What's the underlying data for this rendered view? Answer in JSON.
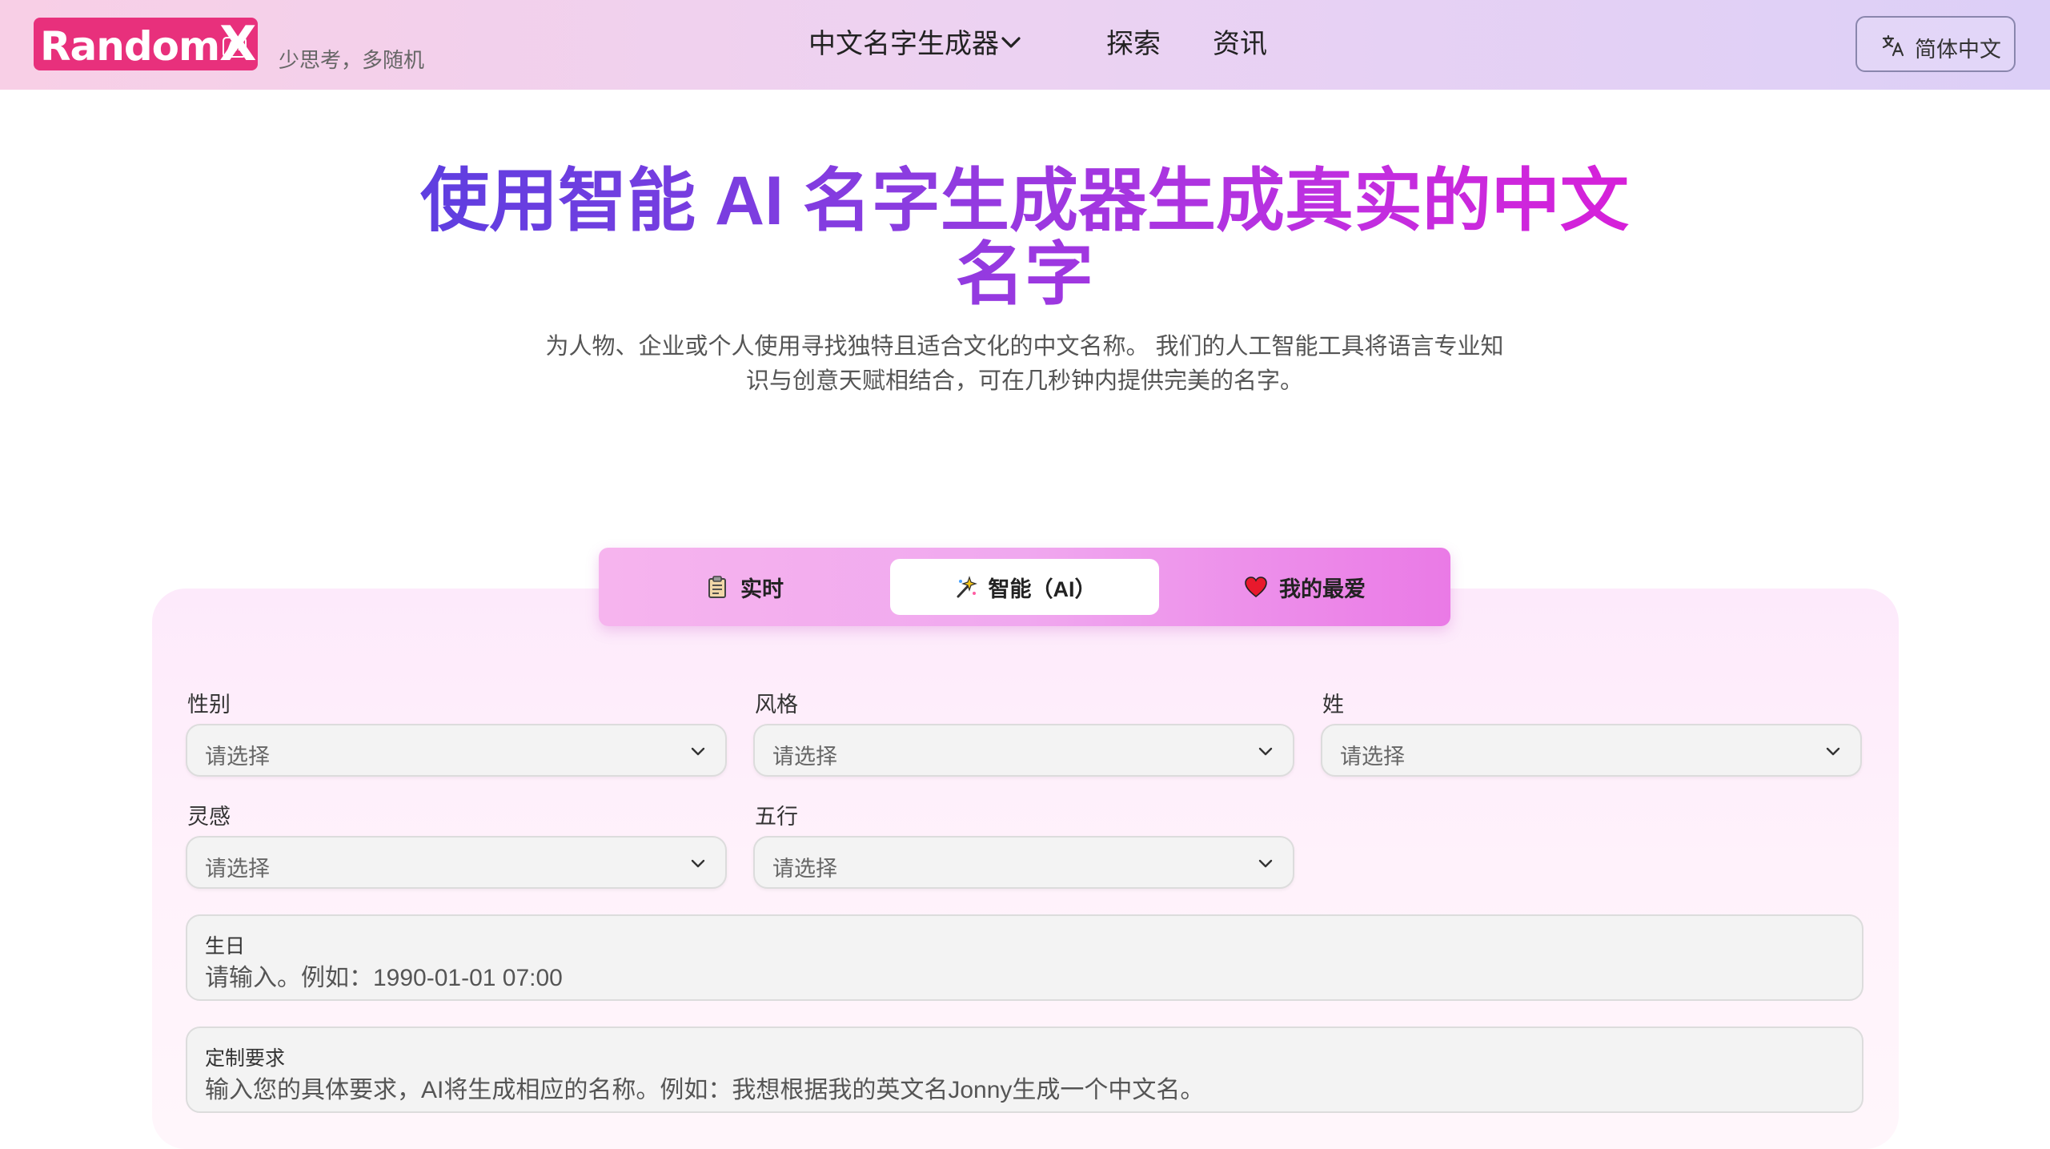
{
  "header": {
    "logo": {
      "brand": "Random",
      "x": "X",
      "ai": "AI"
    },
    "tagline": "少思考，多随机",
    "nav": {
      "generator": "中文名字生成器",
      "explore": "探索",
      "news": "资讯"
    },
    "language": "简体中文"
  },
  "hero": {
    "title_line1": "使用智能 AI 名字生成器生成真实的中文",
    "title_line2": "名字",
    "subtitle_line1": "为人物、企业或个人使用寻找独特且适合文化的中文名称。 我们的人工智能工具将语言专业知",
    "subtitle_line2": "识与创意天赋相结合，可在几秒钟内提供完美的名字。"
  },
  "tabs": [
    {
      "label": "实时",
      "icon": "clipboard-icon",
      "active": false
    },
    {
      "label": "智能（AI）",
      "icon": "sparkle-wand-icon",
      "active": true
    },
    {
      "label": "我的最爱",
      "icon": "heart-icon",
      "active": false
    }
  ],
  "form": {
    "gender": {
      "label": "性别",
      "placeholder": "请选择"
    },
    "style": {
      "label": "风格",
      "placeholder": "请选择"
    },
    "surname": {
      "label": "姓",
      "placeholder": "请选择"
    },
    "inspiration": {
      "label": "灵感",
      "placeholder": "请选择"
    },
    "five_elements": {
      "label": "五行",
      "placeholder": "请选择"
    },
    "birthday": {
      "label": "生日",
      "placeholder": "请输入。例如：1990-01-01 07:00"
    },
    "custom": {
      "label": "定制要求",
      "placeholder": "输入您的具体要求，AI将生成相应的名称。例如：我想根据我的英文名Jonny生成一个中文名。"
    }
  },
  "colors": {
    "brand_pink": "#e8307c",
    "title_gradient_start": "#5b3fe0",
    "title_gradient_end": "#d91ed8",
    "tab_bar": "#f0a8ef"
  }
}
